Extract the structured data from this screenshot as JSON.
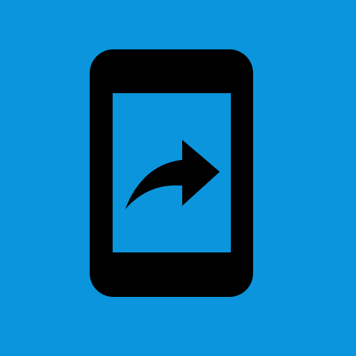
{
  "icon": {
    "name": "phone-forward-icon",
    "background_color": "#0b95dc",
    "foreground_color": "#000000"
  }
}
